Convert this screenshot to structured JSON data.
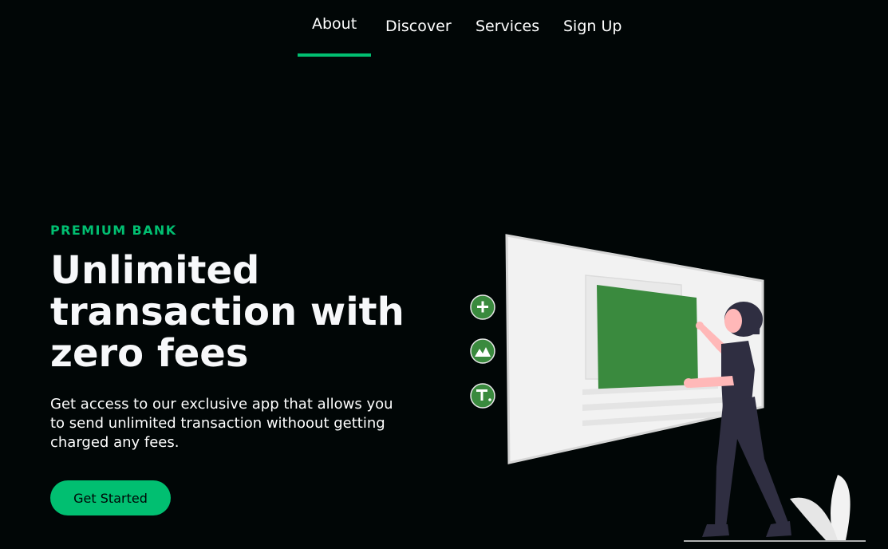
{
  "nav": {
    "items": [
      {
        "label": "About",
        "active": true
      },
      {
        "label": "Discover"
      },
      {
        "label": "Services"
      },
      {
        "label": "Sign Up"
      }
    ]
  },
  "hero": {
    "eyebrow": "PREMIUM BANK",
    "headline": "Unlimited transaction with zero fees",
    "description": "Get access to our exclusive app that allows you to send unlimited transaction withoout getting charged any fees.",
    "cta_label": "Get Started"
  },
  "colors": {
    "background": "#010606",
    "accent": "#01bf71",
    "illustration_green": "#3a8a3e"
  },
  "illustration": {
    "icons": [
      "plus-icon",
      "image-icon",
      "text-icon"
    ]
  }
}
